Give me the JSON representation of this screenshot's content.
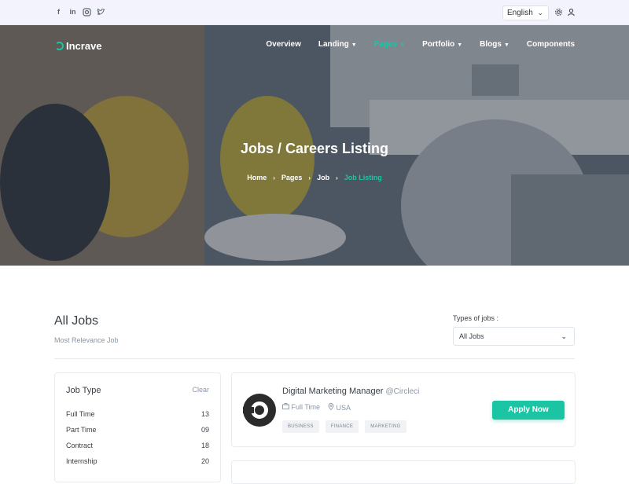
{
  "topbar": {
    "social_icons": [
      "facebook-icon",
      "linkedin-icon",
      "instagram-icon",
      "twitter-icon"
    ],
    "language": "English",
    "icons": [
      "settings-icon",
      "user-icon"
    ]
  },
  "brand": {
    "name": "Incrave",
    "accent": "#1bc5a3"
  },
  "nav": {
    "items": [
      {
        "label": "Overview",
        "dropdown": false,
        "active": false
      },
      {
        "label": "Landing",
        "dropdown": true,
        "active": false
      },
      {
        "label": "Pages",
        "dropdown": true,
        "active": true
      },
      {
        "label": "Portfolio",
        "dropdown": true,
        "active": false
      },
      {
        "label": "Blogs",
        "dropdown": true,
        "active": false
      },
      {
        "label": "Components",
        "dropdown": false,
        "active": false
      }
    ]
  },
  "hero": {
    "title": "Jobs / Careers Listing",
    "breadcrumb": [
      "Home",
      "Pages",
      "Job",
      "Job Listing"
    ]
  },
  "listing": {
    "title": "All Jobs",
    "subtitle": "Most Relevance Job",
    "types_label": "Types of jobs :",
    "types_selected": "All Jobs"
  },
  "filter": {
    "title": "Job Type",
    "clear": "Clear",
    "rows": [
      {
        "label": "Full Time",
        "count": "13"
      },
      {
        "label": "Part Time",
        "count": "09"
      },
      {
        "label": "Contract",
        "count": "18"
      },
      {
        "label": "Internship",
        "count": "20"
      }
    ]
  },
  "jobs": [
    {
      "title": "Digital Marketing Manager",
      "company": "@Circleci",
      "type": "Full Time",
      "location": "USA",
      "tags": [
        "BUSINESS",
        "FINANCE",
        "MARKETING"
      ],
      "apply": "Apply Now"
    }
  ]
}
